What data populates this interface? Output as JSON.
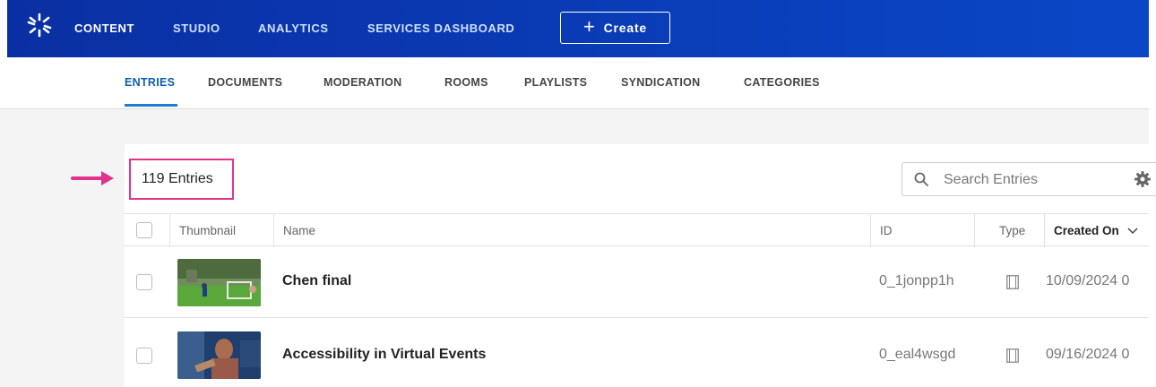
{
  "topnav": {
    "items": [
      "CONTENT",
      "STUDIO",
      "ANALYTICS",
      "SERVICES DASHBOARD"
    ],
    "create_label": "Create",
    "colors": {
      "bar": "#0a3db8",
      "accent": "#1b7fd1"
    }
  },
  "subnav": {
    "tabs": [
      "ENTRIES",
      "DOCUMENTS",
      "MODERATION",
      "ROOMS",
      "PLAYLISTS",
      "SYNDICATION",
      "CATEGORIES"
    ],
    "active": "ENTRIES"
  },
  "entries": {
    "count_label": "119 Entries",
    "highlight_color": "#e0338c"
  },
  "search": {
    "placeholder": "Search Entries"
  },
  "table": {
    "columns": [
      "Thumbnail",
      "Name",
      "ID",
      "Type",
      "Created On"
    ],
    "rows": [
      {
        "name": "Chen final",
        "id": "0_1jonpp1h",
        "type_icon": "video-icon",
        "created_on": "10/09/2024 0"
      },
      {
        "name": "Accessibility in Virtual Events",
        "id": "0_eal4wsgd",
        "type_icon": "video-icon",
        "created_on": "09/16/2024 0"
      }
    ]
  }
}
